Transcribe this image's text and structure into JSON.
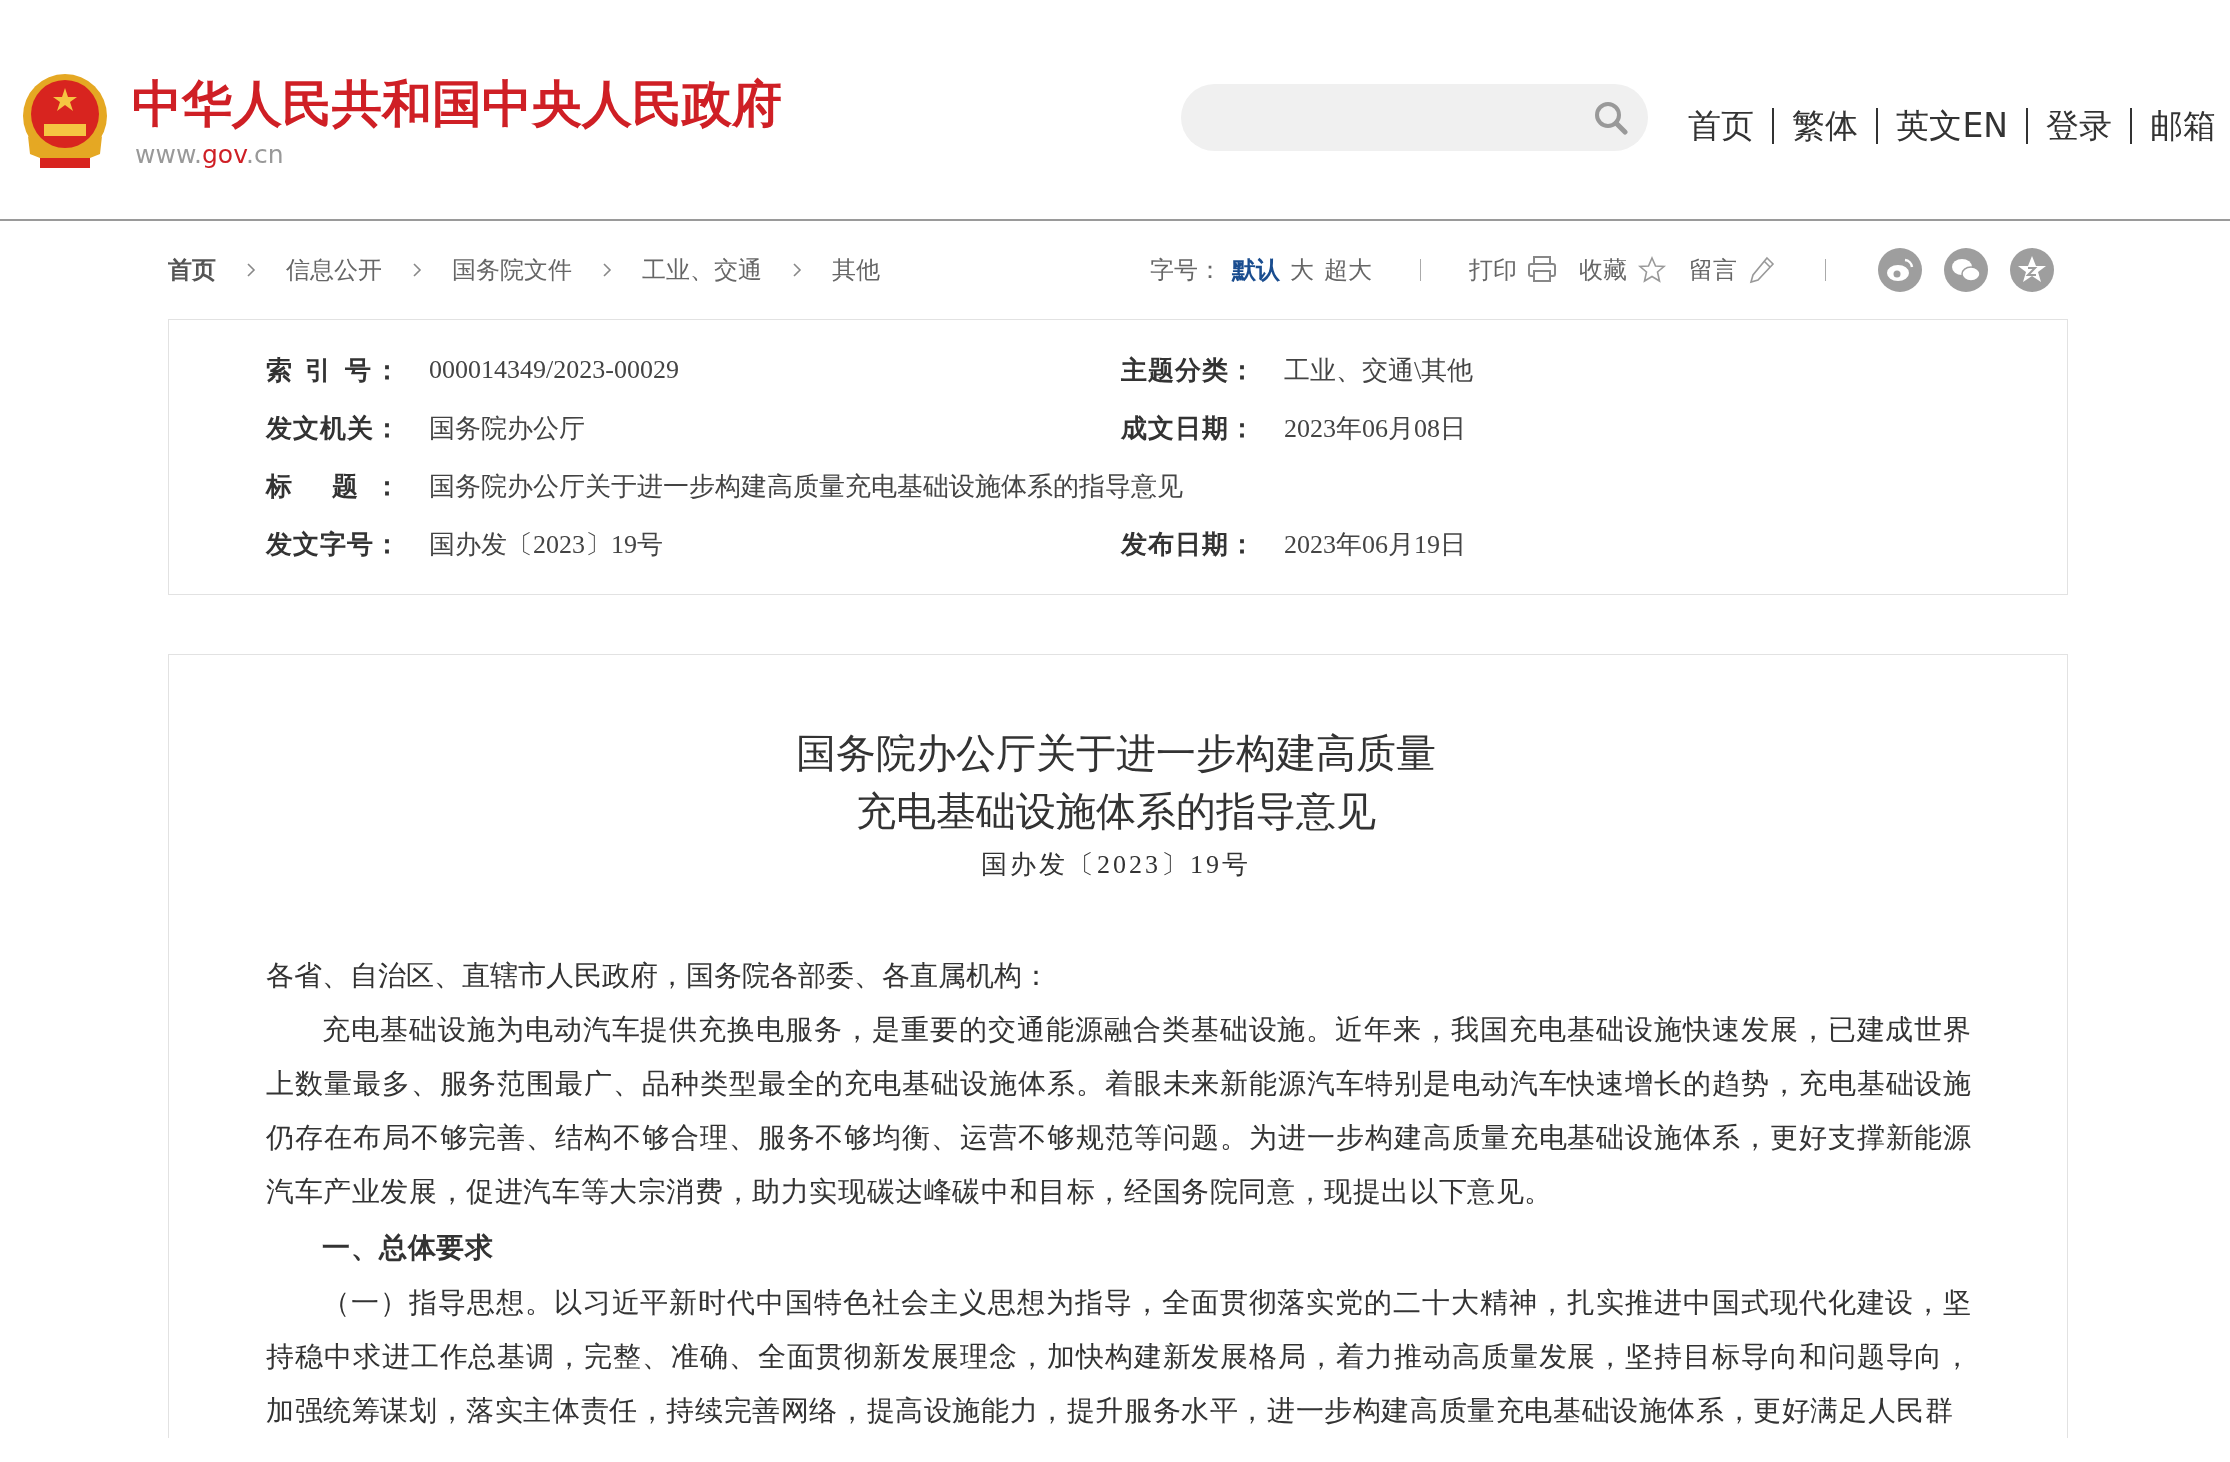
{
  "header": {
    "site_title": "中华人民共和国中央人民政府",
    "site_url": [
      {
        "text": "www.",
        "highlight": false
      },
      {
        "text": "gov",
        "highlight": true
      },
      {
        "text": ".cn",
        "highlight": false
      }
    ],
    "nav": [
      "首页",
      "繁体",
      "英文EN",
      "登录",
      "邮箱"
    ]
  },
  "breadcrumb": [
    "首页",
    "信息公开",
    "国务院文件",
    "工业、交通",
    "其他"
  ],
  "toolbar": {
    "font_size_label": "字号：",
    "font_sizes": [
      {
        "label": "默认",
        "selected": true
      },
      {
        "label": "大",
        "selected": false
      },
      {
        "label": "超大",
        "selected": false
      }
    ],
    "actions": [
      {
        "label": "打印",
        "kind": "print"
      },
      {
        "label": "收藏",
        "kind": "favorite"
      },
      {
        "label": "留言",
        "kind": "comment"
      }
    ],
    "share": [
      {
        "kind": "weibo"
      },
      {
        "kind": "wechat"
      },
      {
        "kind": "star"
      }
    ]
  },
  "metadata": {
    "rows": [
      [
        {
          "label": "索 引 号：",
          "value": "000014349/2023-00029"
        },
        {
          "label": "主题分类：",
          "value": "工业、交通\\其他"
        }
      ],
      [
        {
          "label": "发文机关：",
          "value": "国务院办公厅"
        },
        {
          "label": "成文日期：",
          "value": "2023年06月08日"
        }
      ],
      [
        {
          "label": "标 题：",
          "value": "国务院办公厅关于进一步构建高质量充电基础设施体系的指导意见"
        }
      ],
      [
        {
          "label": "发文字号：",
          "value": "国办发〔2023〕19号"
        },
        {
          "label": "发布日期：",
          "value": "2023年06月19日"
        }
      ]
    ]
  },
  "article": {
    "title_lines": [
      "国务院办公厅关于进一步构建高质量",
      "充电基础设施体系的指导意见"
    ],
    "doc_number": "国办发〔2023〕19号",
    "salutation": "各省、自治区、直辖市人民政府，国务院各部委、各直属机构：",
    "paragraphs": [
      {
        "kind": "body",
        "text": "充电基础设施为电动汽车提供充换电服务，是重要的交通能源融合类基础设施。近年来，我国充电基础设施快速发展，已建成世界上数量最多、服务范围最广、品种类型最全的充电基础设施体系。着眼未来新能源汽车特别是电动汽车快速增长的趋势，充电基础设施仍存在布局不够完善、结构不够合理、服务不够均衡、运营不够规范等问题。为进一步构建高质量充电基础设施体系，更好支撑新能源汽车产业发展，促进汽车等大宗消费，助力实现碳达峰碳中和目标，经国务院同意，现提出以下意见。"
      },
      {
        "kind": "heading",
        "text": "一、总体要求"
      },
      {
        "kind": "body",
        "text": "（一）指导思想。以习近平新时代中国特色社会主义思想为指导，全面贯彻落实党的二十大精神，扎实推进中国式现代化建设，坚持稳中求进工作总基调，完整、准确、全面贯彻新发展理念，加快构建新发展格局，着力推动高质量发展，坚持目标导向和问题导向，加强统筹谋划，落实主体责任，持续完善网络，提高设施能力，提升服务水平，进一步构建高质量充电基础设施体系，更好满足人民群"
      }
    ]
  }
}
